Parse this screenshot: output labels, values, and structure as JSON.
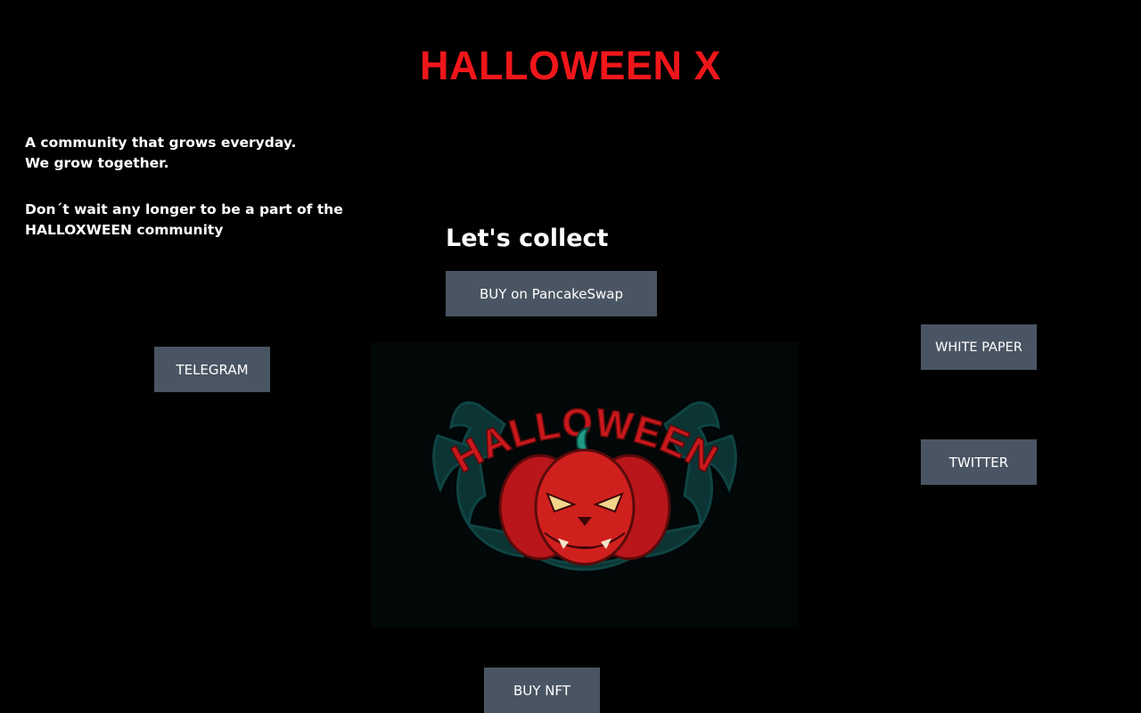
{
  "header": {
    "title": "HALLOWEEN X"
  },
  "intro": {
    "line1": "A community that grows everyday.",
    "line2": "We grow together.",
    "line3": "Don´t wait any longer to be a part of the",
    "line4": "HALLOXWEEN community"
  },
  "collect": {
    "heading": "Let's collect",
    "buy_pancake_label": "BUY on PancakeSwap",
    "buy_nft_label": "BUY NFT"
  },
  "social": {
    "telegram_label": "TELEGRAM",
    "white_paper_label": "WHITE PAPER",
    "twitter_label": "TWITTER"
  },
  "logo": {
    "icon": "halloween-pumpkin-logo",
    "text": "HALLOWEEN"
  },
  "colors": {
    "background": "#000000",
    "title_red": "#f0161a",
    "button_bg": "#4a5563",
    "logo_panel": "#020708",
    "pumpkin_red": "#c8181c",
    "frame_teal": "#0d3a3a"
  }
}
